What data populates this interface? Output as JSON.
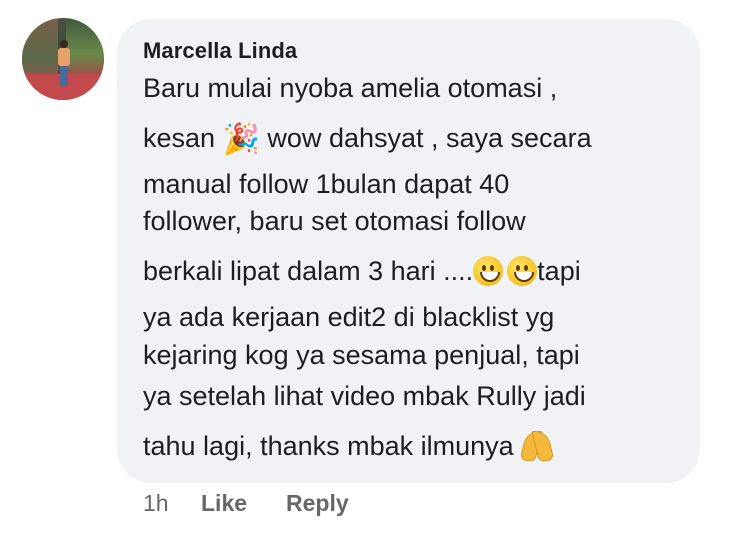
{
  "comment": {
    "author": "Marcella Linda",
    "lines": [
      {
        "text_before": "Baru mulai nyoba amelia otomasi ,"
      },
      {
        "text_before": "kesan ",
        "emoji": "🎉",
        "emoji_name": "party-popper-icon",
        "text_after": " wow dahsyat , saya secara"
      },
      {
        "text_before": "manual follow 1bulan dapat 40"
      },
      {
        "text_before": "follower, baru set otomasi follow"
      },
      {
        "text_before": "berkali lipat dalam 3 hari ....",
        "text_after": "tapi"
      },
      {
        "text_before": "ya ada kerjaan edit2 di blacklist yg"
      },
      {
        "text_before": "kejaring kog ya sesama penjual, tapi"
      },
      {
        "text_before": "ya setelah lihat video mbak Rully jadi"
      },
      {
        "text_before": "tahu lagi, thanks mbak ilmunya "
      }
    ]
  },
  "actions": {
    "time": "1h",
    "like": "Like",
    "reply": "Reply"
  },
  "icons": {
    "avatar": "profile-photo",
    "smile_emoji": "grinning-face-icon",
    "pray_emoji": "folded-hands-icon"
  },
  "colors": {
    "bubble_bg": "#f0f2f5",
    "text": "#1c1e21",
    "meta_text": "#65676b"
  }
}
